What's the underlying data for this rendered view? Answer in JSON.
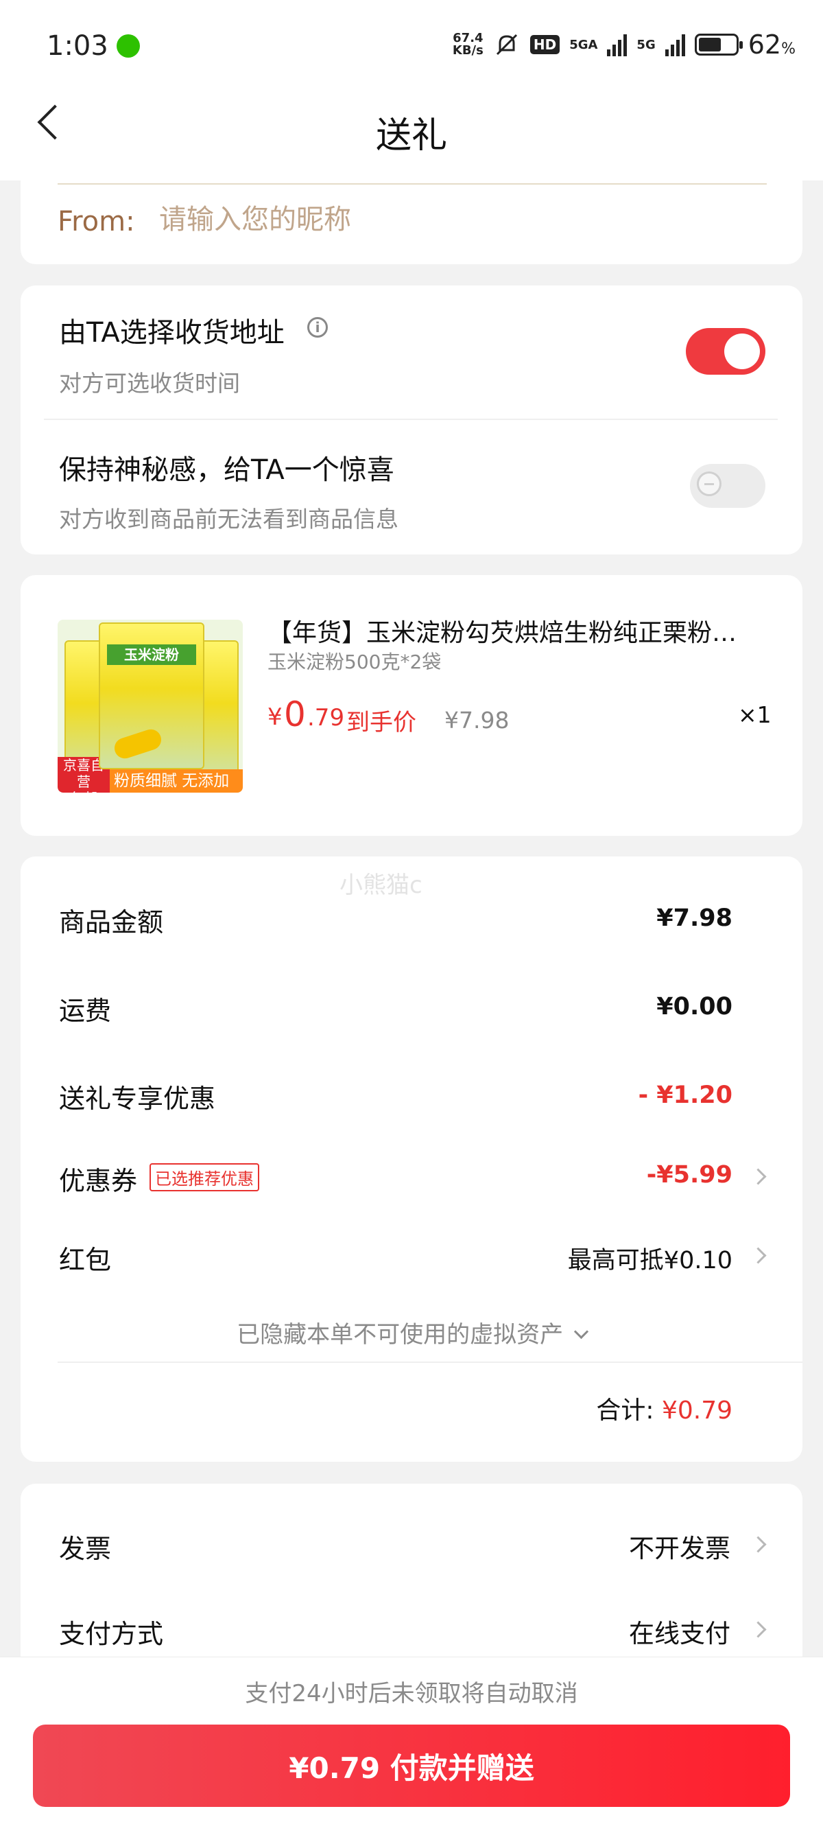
{
  "status_bar": {
    "time": "1:03",
    "net_speed": "67.4",
    "net_speed_unit": "KB/s",
    "hd": "HD",
    "net1": "5GA",
    "net2": "5G",
    "battery_level": 62,
    "battery_pct": "62",
    "battery_pct_sign": "%"
  },
  "header": {
    "title": "送礼"
  },
  "from": {
    "label": "From:",
    "placeholder": "请输入您的昵称"
  },
  "options": {
    "address": {
      "title": "由TA选择收货地址",
      "subtitle": "对方可选收货时间",
      "enabled": true
    },
    "mystery": {
      "title": "保持神秘感，给TA一个惊喜",
      "subtitle": "对方收到商品前无法看到商品信息",
      "enabled": false
    }
  },
  "product": {
    "name": "【年货】玉米淀粉勾芡烘焙生粉纯正栗粉…",
    "spec": "玉米淀粉500克*2袋",
    "image_label": "玉米淀粉",
    "badge_jd": "京喜自营",
    "badge_free": "包邮",
    "badge_tag": "粉质细腻 无添加剂",
    "price_symbol": "¥",
    "price_int": "0",
    "price_dec": ".79",
    "price_label": "到手价",
    "original_price": "¥7.98",
    "quantity": "×1"
  },
  "fees": {
    "watermark": "小熊猫c",
    "rows": [
      {
        "label": "商品金额",
        "value": "¥7.98"
      },
      {
        "label": "运费",
        "value": "¥0.00"
      },
      {
        "label": "送礼专享优惠",
        "value": "- ¥1.20"
      },
      {
        "label": "优惠券",
        "tag": "已选推荐优惠",
        "value": "-¥5.99"
      },
      {
        "label": "红包",
        "value": "最高可抵¥0.10"
      }
    ],
    "hidden_assets": "已隐藏本单不可使用的虚拟资产",
    "total_label": "合计:",
    "total_value": "¥0.79"
  },
  "invoice": {
    "rows": [
      {
        "label": "发票",
        "value": "不开发票"
      },
      {
        "label": "支付方式",
        "value": "在线支付"
      }
    ]
  },
  "bottom": {
    "notice": "支付24小时后未领取将自动取消",
    "pay_button": "¥0.79 付款并赠送"
  },
  "colors": {
    "accent": "#e8322f",
    "button_start": "#f04854",
    "button_end": "#ff1f2d"
  }
}
